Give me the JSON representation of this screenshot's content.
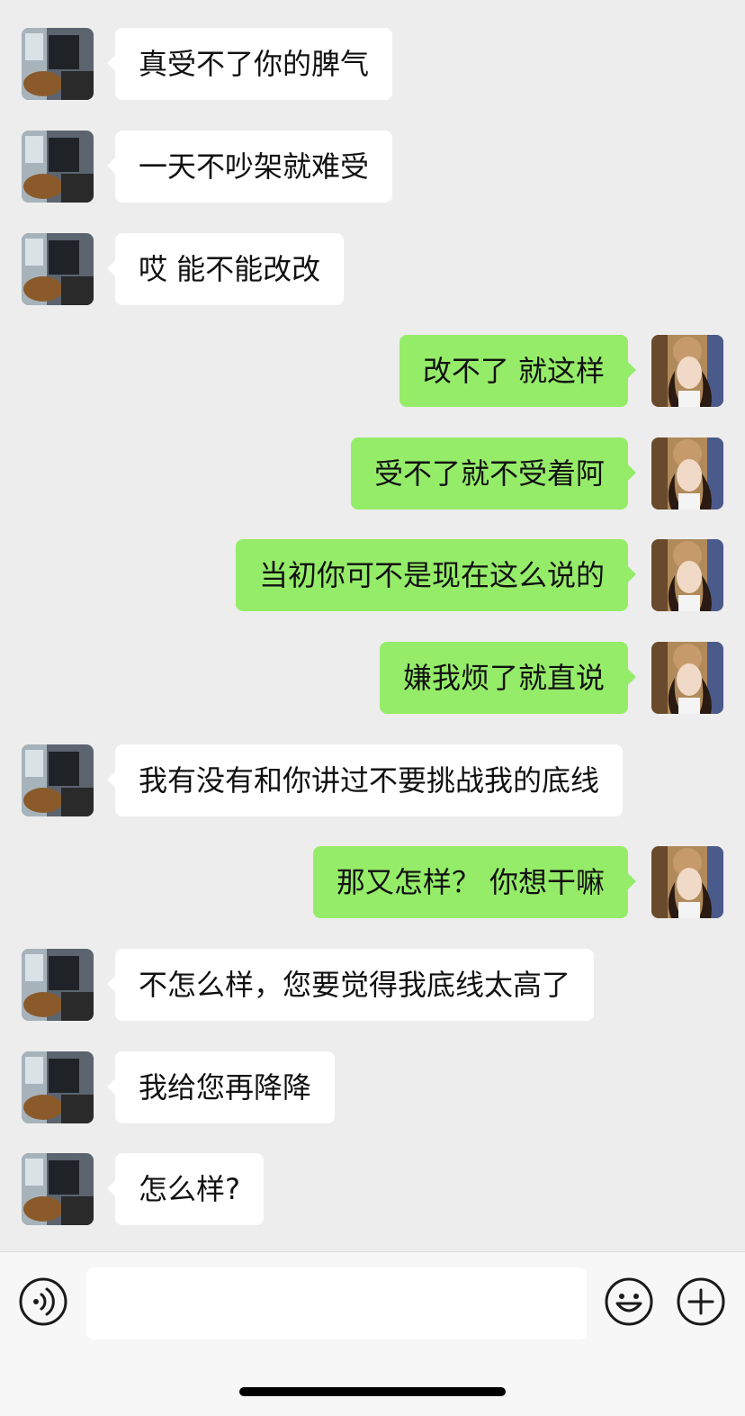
{
  "messages": [
    {
      "side": "left",
      "text": "真受不了你的脾气"
    },
    {
      "side": "left",
      "text": "一天不吵架就难受"
    },
    {
      "side": "left",
      "text": "哎 能不能改改"
    },
    {
      "side": "right",
      "text": "改不了 就这样"
    },
    {
      "side": "right",
      "text": "受不了就不受着阿"
    },
    {
      "side": "right",
      "text": "当初你可不是现在这么说的"
    },
    {
      "side": "right",
      "text": "嫌我烦了就直说"
    },
    {
      "side": "left",
      "text": "我有没有和你讲过不要挑战我的底线"
    },
    {
      "side": "right",
      "text": "那又怎样？ 你想干嘛"
    },
    {
      "side": "left",
      "text": "不怎么样，您要觉得我底线太高了"
    },
    {
      "side": "left",
      "text": "我给您再降降"
    },
    {
      "side": "left",
      "text": "怎么样?"
    }
  ],
  "input": {
    "value": "",
    "placeholder": ""
  },
  "icons": {
    "voice": "voice-icon",
    "emoji": "emoji-icon",
    "more": "plus-icon"
  },
  "colors": {
    "background": "#ededed",
    "incoming_bubble": "#ffffff",
    "outgoing_bubble": "#95ec69"
  }
}
